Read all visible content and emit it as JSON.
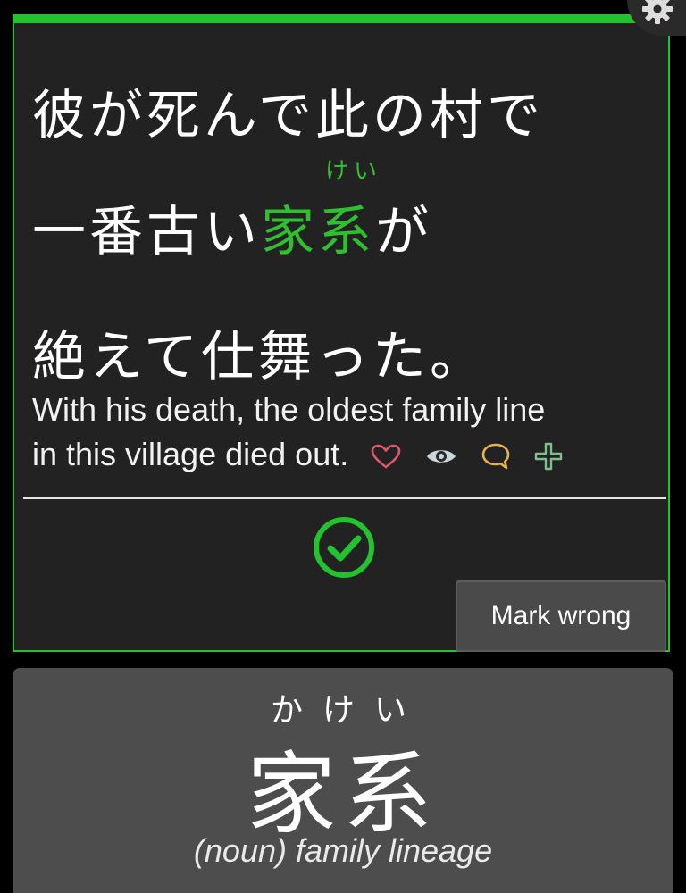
{
  "sentence": {
    "line1": "彼が死んで此の村で",
    "line2_before": "一番古い",
    "target_word": "家系",
    "target_furigana": "けい",
    "line2_after": "が",
    "line3": "絶えて仕舞った。"
  },
  "translation": {
    "line1": "With his death, the oldest family line",
    "line2": "in this village died out."
  },
  "icons": {
    "favorite": "heart-icon",
    "visibility": "eye-icon",
    "comment": "speech-bubble-icon",
    "add": "plus-icon",
    "result": "check-circle-icon",
    "settings": "gear-icon"
  },
  "colors": {
    "accent_green": "#22c32e",
    "heart": "#e0566b",
    "eye": "#c9d6dc",
    "comment": "#e6b54a",
    "plus": "#7fbf8a"
  },
  "actions": {
    "mark_wrong_label": "Mark wrong"
  },
  "vocab": {
    "reading": "かけい",
    "word": "家系",
    "meaning": "(noun) family lineage"
  }
}
